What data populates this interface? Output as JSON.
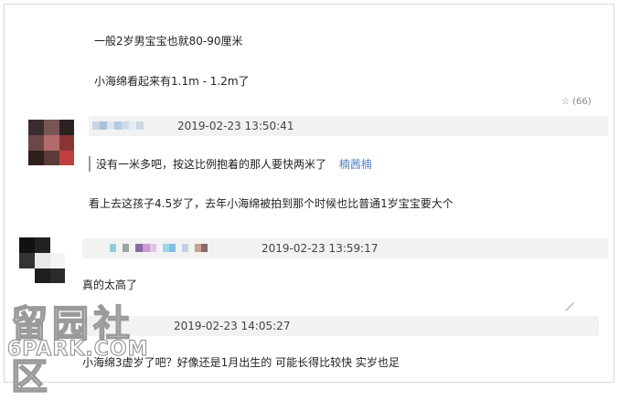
{
  "comments": {
    "c1": {
      "line1": "一般2岁男宝宝也就80-90厘米",
      "line2": "小海绵看起来有1.1m - 1.2m了",
      "likes": "☆ (66)"
    },
    "c2": {
      "timestamp": "2019-02-23 13:50:41",
      "quote_text": "没有一米多吧，按这比例抱着的那人要快两米了",
      "quote_user": "楠茜楠",
      "body": "看上去这孩子4.5岁了，去年小海绵被拍到那个时候也比普通1岁宝宝要大个"
    },
    "c3": {
      "timestamp": "2019-02-23 13:59:17",
      "body": "真的太高了"
    },
    "c4": {
      "timestamp": "2019-02-23 14:05:27",
      "body": "小海绵3虚岁了吧？好像还是1月出生的 可能长得比较快 实岁也足"
    }
  },
  "watermark": {
    "cn": "留园社区",
    "en": "6PARK.COM"
  }
}
